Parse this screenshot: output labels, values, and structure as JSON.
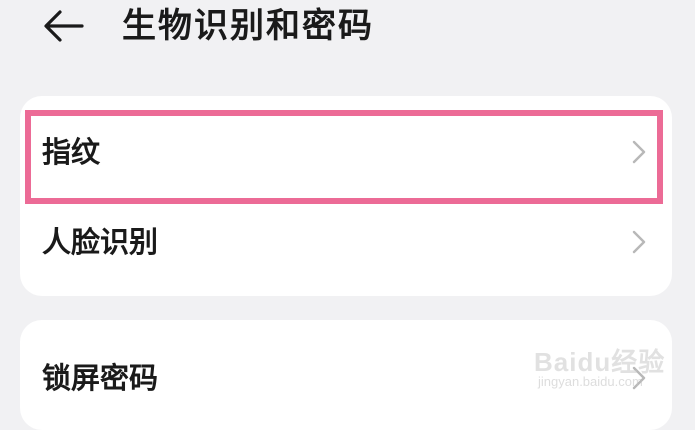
{
  "header": {
    "title": "生物识别和密码",
    "back_icon": "arrow-left-icon"
  },
  "sections": [
    {
      "items": [
        {
          "label": "指纹"
        },
        {
          "label": "人脸识别"
        }
      ]
    },
    {
      "items": [
        {
          "label": "锁屏密码"
        }
      ]
    }
  ],
  "highlight": {
    "color": "#ec6b96"
  },
  "watermark": {
    "logo": "Baidu经验",
    "url": "jingyan.baidu.com"
  }
}
